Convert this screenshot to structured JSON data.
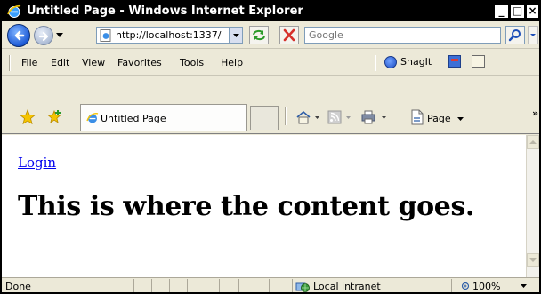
{
  "window": {
    "title": "Untitled Page - Windows Internet Explorer",
    "min_glyph": "_",
    "max_glyph": "□",
    "close_glyph": "×"
  },
  "address_bar": {
    "url": "http://localhost:1337/",
    "search_placeholder": "Google"
  },
  "menu": {
    "items": [
      "File",
      "Edit",
      "View",
      "Favorites",
      "Tools",
      "Help"
    ],
    "snagit_label": "SnagIt"
  },
  "tabs": {
    "active_label": "Untitled Page"
  },
  "command_bar": {
    "page_label": "Page"
  },
  "content": {
    "login_link": "Login",
    "heading": "This is where the content goes."
  },
  "status_bar": {
    "status": "Done",
    "zone": "Local intranet",
    "zoom": "100%"
  },
  "icons": {
    "app": "ie-logo-icon",
    "back": "back-arrow-icon",
    "forward": "forward-arrow-icon",
    "refresh": "refresh-icon",
    "stop": "stop-icon",
    "search": "search-icon",
    "favorites": "favorites-star-icon",
    "add_favorite": "add-favorite-icon",
    "home": "home-icon",
    "feeds": "feeds-icon",
    "print": "print-icon",
    "page": "page-icon"
  },
  "colors": {
    "link": "#0000ee",
    "ie_blue": "#1e5bd6",
    "stop_red": "#d6302b",
    "refresh_green": "#2a9a2a"
  }
}
